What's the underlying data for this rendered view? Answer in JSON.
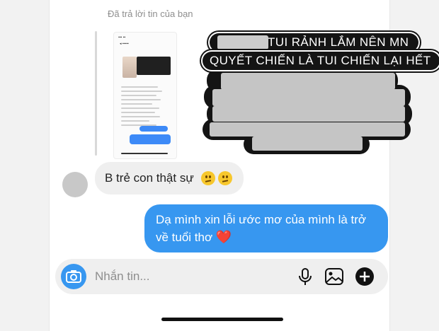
{
  "reply_context": {
    "label": "Đã trả lời tin của bạn"
  },
  "overlay_caption": {
    "line1": "TUI RẢNH LẮM NÊN MN",
    "line2": "QUYẾT CHIẾN LÀ TUI CHIẾN LẠI HẾT"
  },
  "messages": {
    "received": {
      "text": "B trẻ con thật sự",
      "emojis": [
        "confused-face",
        "confused-face"
      ]
    },
    "sent": {
      "text": "Dạ mình xin lỗi ước mơ của mình là trở về tuổi thơ",
      "heart": "❤️"
    }
  },
  "composer": {
    "placeholder": "Nhắn tin...",
    "icons": [
      "camera-icon",
      "microphone-icon",
      "gallery-icon",
      "plus-icon"
    ]
  },
  "colors": {
    "sent_bubble": "#3797f0",
    "received_bubble": "#efefef",
    "accent": "#3797f0"
  }
}
